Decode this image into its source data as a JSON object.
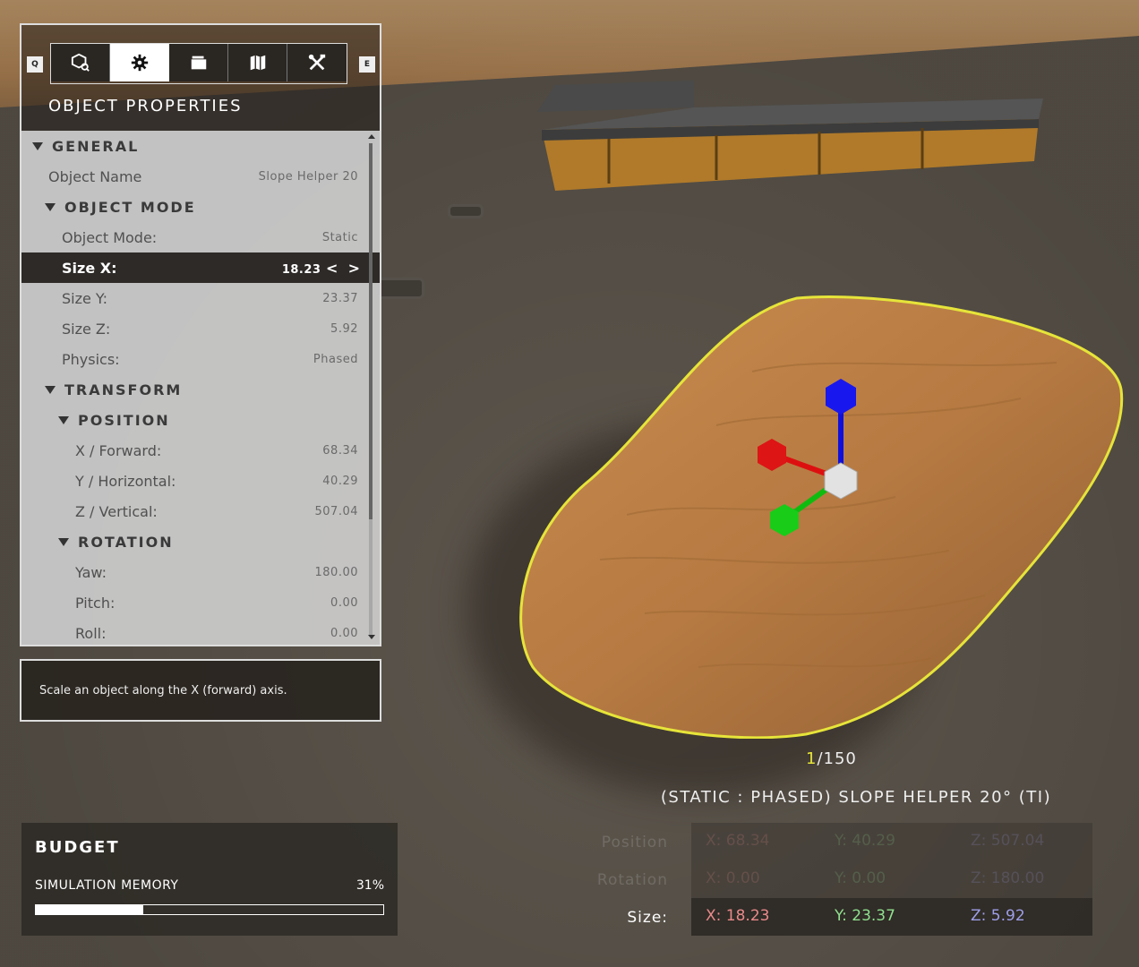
{
  "toolbar": {
    "left_key": "Q",
    "right_key": "E",
    "tabs": [
      {
        "icon": "object-browser-icon",
        "active": false
      },
      {
        "icon": "gear-icon",
        "active": true
      },
      {
        "icon": "folder-icon",
        "active": false
      },
      {
        "icon": "map-icon",
        "active": false
      },
      {
        "icon": "tools-icon",
        "active": false
      }
    ]
  },
  "panel": {
    "title": "OBJECT PROPERTIES",
    "general": "GENERAL",
    "object_name_label": "Object Name",
    "object_name_value": "Slope Helper 20",
    "object_mode_section": "OBJECT MODE",
    "object_mode_label": "Object Mode:",
    "object_mode_value": "Static",
    "size_x_label": "Size X:",
    "size_x_value": "18.23",
    "size_y_label": "Size Y:",
    "size_y_value": "23.37",
    "size_z_label": "Size Z:",
    "size_z_value": "5.92",
    "physics_label": "Physics:",
    "physics_value": "Phased",
    "transform_section": "TRANSFORM",
    "position_section": "POSITION",
    "x_label": "X / Forward:",
    "x_value": "68.34",
    "y_label": "Y / Horizontal:",
    "y_value": "40.29",
    "z_label": "Z / Vertical:",
    "z_value": "507.04",
    "rotation_section": "ROTATION",
    "yaw_label": "Yaw:",
    "yaw_value": "180.00",
    "pitch_label": "Pitch:",
    "pitch_value": "0.00",
    "roll_label": "Roll:",
    "roll_value": "0.00"
  },
  "description": "Scale an object along the X (forward) axis.",
  "budget": {
    "title": "BUDGET",
    "label": "SIMULATION MEMORY",
    "value": "31%",
    "fraction": 0.31
  },
  "object_info": {
    "current": "1",
    "total": "/150",
    "name": "(STATIC : PHASED) SLOPE HELPER 20° (TI)"
  },
  "readout": {
    "position_label": "Position",
    "rotation_label": "Rotation",
    "size_label": "Size:",
    "position": {
      "x": "X: 68.34",
      "y": "Y: 40.29",
      "z": "Z: 507.04"
    },
    "rotation": {
      "x": "X: 0.00",
      "y": "Y: 0.00",
      "z": "Z: 180.00"
    },
    "size": {
      "x": "X: 18.23",
      "y": "Y: 23.37",
      "z": "Z: 5.92"
    }
  },
  "colors": {
    "axis_x": "#e88a8a",
    "axis_y": "#8fe08f",
    "axis_z": "#9e9ee8",
    "selection_outline": "#e6e43a"
  }
}
